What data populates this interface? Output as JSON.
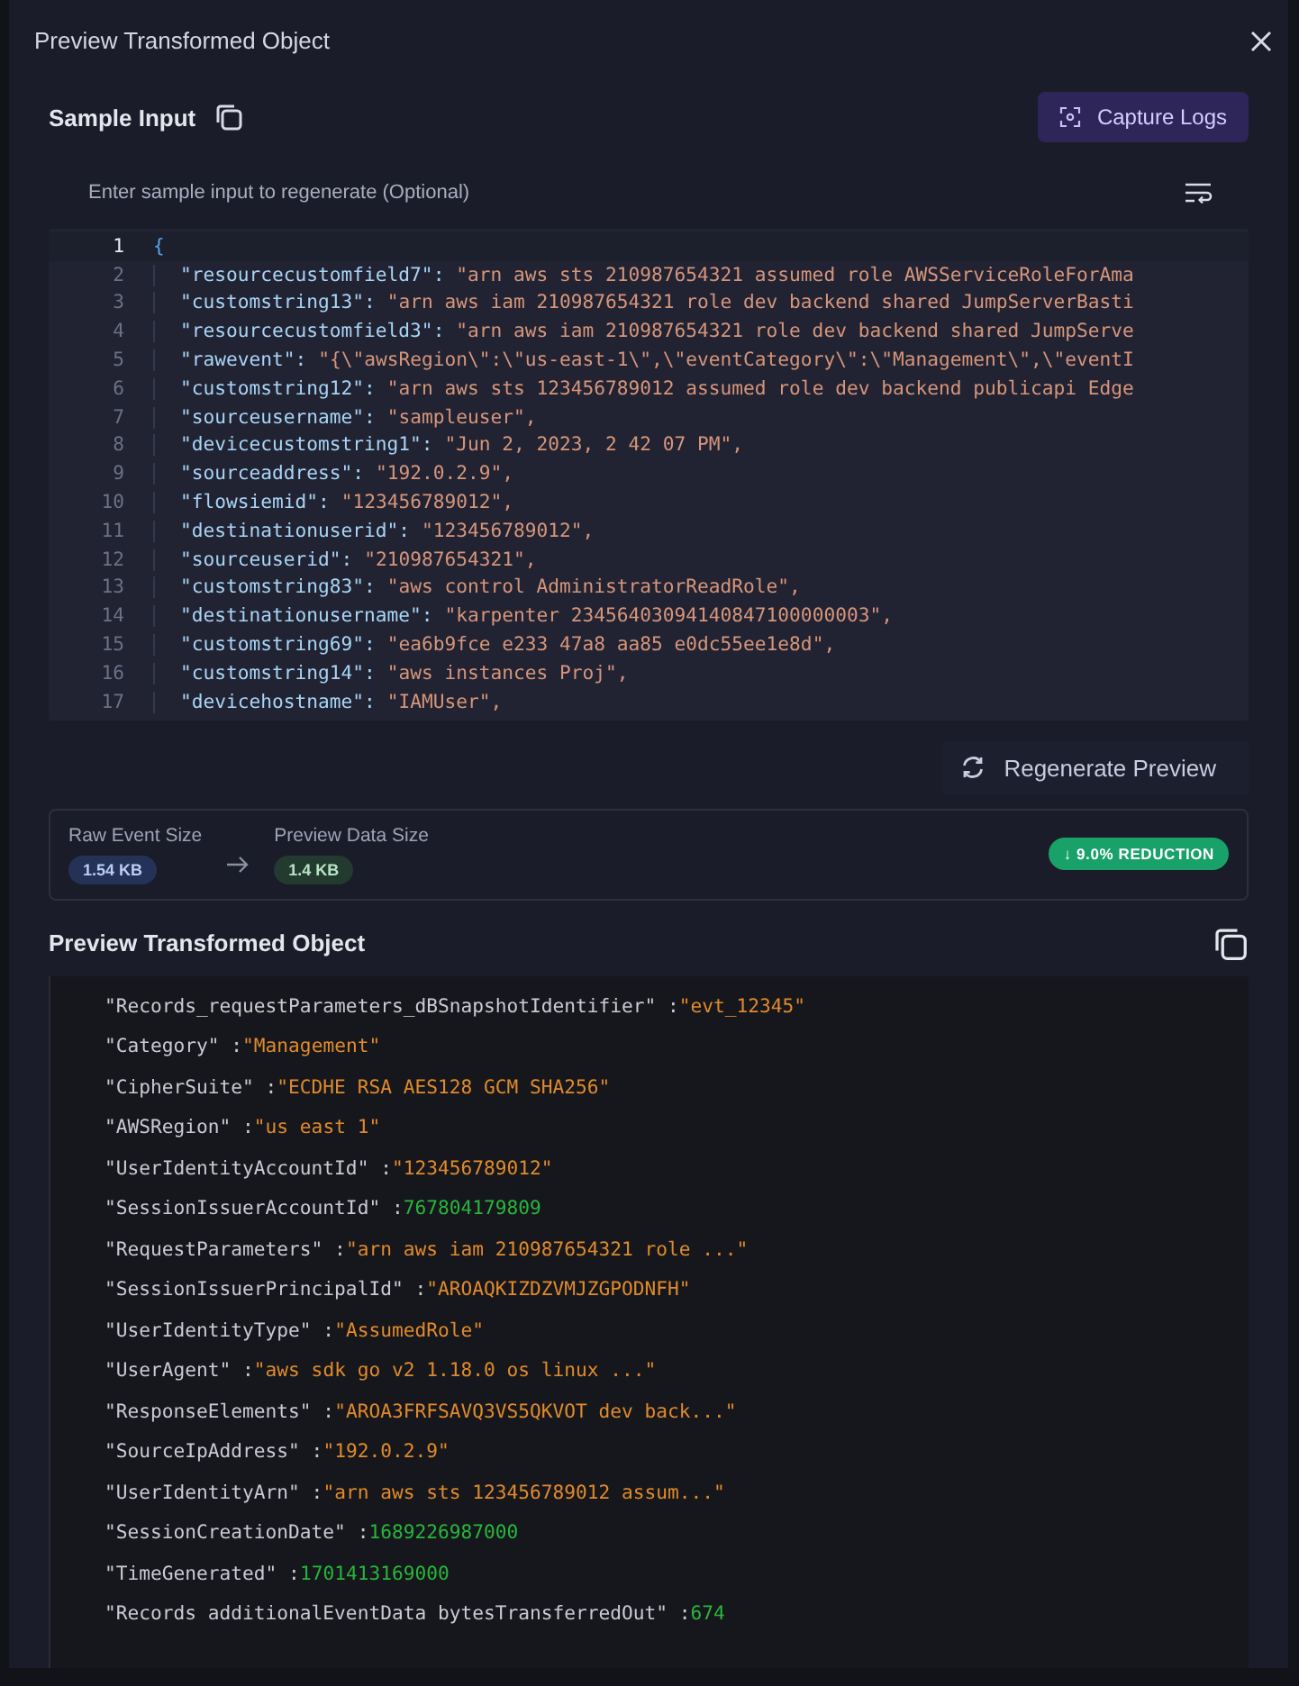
{
  "dialog": {
    "title": "Preview Transformed Object"
  },
  "sample_input": {
    "heading": "Sample Input",
    "capture_button": "Capture Logs",
    "hint": "Enter sample input to regenerate (Optional)",
    "editor_lines": [
      {
        "number": "1",
        "kind": "brace",
        "text": "{",
        "selected": true
      },
      {
        "number": "2",
        "kind": "pair",
        "key": "\"resourcecustomfield7\":",
        "value": "\"arn aws sts 210987654321 assumed role AWSServiceRoleForAma",
        "selected": false
      },
      {
        "number": "3",
        "kind": "pair",
        "key": "\"customstring13\":",
        "value": "\"arn aws iam 210987654321 role dev backend shared JumpServerBasti",
        "selected": false
      },
      {
        "number": "4",
        "kind": "pair",
        "key": "\"resourcecustomfield3\":",
        "value": "\"arn aws iam 210987654321 role dev backend shared JumpServe",
        "selected": false
      },
      {
        "number": "5",
        "kind": "pair",
        "key": "\"rawevent\":",
        "value": "\"{\\\"awsRegion\\\":\\\"us-east-1\\\",\\\"eventCategory\\\":\\\"Management\\\",\\\"eventI",
        "selected": false
      },
      {
        "number": "6",
        "kind": "pair",
        "key": "\"customstring12\":",
        "value": "\"arn aws sts 123456789012 assumed role dev backend publicapi Edge",
        "selected": false
      },
      {
        "number": "7",
        "kind": "pair",
        "key": "\"sourceusername\":",
        "value": "\"sampleuser\",",
        "selected": false
      },
      {
        "number": "8",
        "kind": "pair",
        "key": "\"devicecustomstring1\":",
        "value": "\"Jun 2, 2023, 2 42 07 PM\",",
        "selected": false
      },
      {
        "number": "9",
        "kind": "pair",
        "key": "\"sourceaddress\":",
        "value": "\"192.0.2.9\",",
        "selected": false
      },
      {
        "number": "10",
        "kind": "pair",
        "key": "\"flowsiemid\":",
        "value": "\"123456789012\",",
        "selected": false
      },
      {
        "number": "11",
        "kind": "pair",
        "key": "\"destinationuserid\":",
        "value": "\"123456789012\",",
        "selected": false
      },
      {
        "number": "12",
        "kind": "pair",
        "key": "\"sourceuserid\":",
        "value": "\"210987654321\",",
        "selected": false
      },
      {
        "number": "13",
        "kind": "pair",
        "key": "\"customstring83\":",
        "value": "\"aws control AdministratorReadRole\",",
        "selected": false
      },
      {
        "number": "14",
        "kind": "pair",
        "key": "\"destinationusername\":",
        "value": "\"karpenter 23456403094140847100000003\",",
        "selected": false
      },
      {
        "number": "15",
        "kind": "pair",
        "key": "\"customstring69\":",
        "value": "\"ea6b9fce e233 47a8 aa85 e0dc55ee1e8d\",",
        "selected": false
      },
      {
        "number": "16",
        "kind": "pair",
        "key": "\"customstring14\":",
        "value": "\"aws instances Proj\",",
        "selected": false
      },
      {
        "number": "17",
        "kind": "pair",
        "key": "\"devicehostname\":",
        "value": "\"IAMUser\",",
        "selected": false
      }
    ]
  },
  "regenerate_button": "Regenerate Preview",
  "sizes": {
    "raw_label": "Raw Event Size",
    "raw_value": "1.54 KB",
    "preview_label": "Preview Data Size",
    "preview_value": "1.4 KB",
    "reduction": "↓ 9.0% REDUCTION"
  },
  "preview": {
    "heading": "Preview Transformed Object",
    "fields": [
      {
        "key": "\"Records_requestParameters_dBSnapshotIdentifier\" :",
        "value": "\"evt_12345\"",
        "kind": "string"
      },
      {
        "key": "\"Category\" :",
        "value": "\"Management\"",
        "kind": "string"
      },
      {
        "key": "\"CipherSuite\" :",
        "value": "\"ECDHE RSA AES128 GCM SHA256\"",
        "kind": "string"
      },
      {
        "key": "\"AWSRegion\" :",
        "value": "\"us east 1\"",
        "kind": "string"
      },
      {
        "key": "\"UserIdentityAccountId\" :",
        "value": "\"123456789012\"",
        "kind": "string"
      },
      {
        "key": "\"SessionIssuerAccountId\" :",
        "value": "767804179809",
        "kind": "number"
      },
      {
        "key": "\"RequestParameters\" :",
        "value": "\"arn aws iam 210987654321 role ...\"",
        "kind": "string"
      },
      {
        "key": "\"SessionIssuerPrincipalId\" :",
        "value": "\"AROAQKIZDZVMJZGPODNFH\"",
        "kind": "string"
      },
      {
        "key": "\"UserIdentityType\" :",
        "value": "\"AssumedRole\"",
        "kind": "string"
      },
      {
        "key": "\"UserAgent\" :",
        "value": "\"aws sdk go v2 1.18.0 os linux ...\"",
        "kind": "string"
      },
      {
        "key": "\"ResponseElements\" :",
        "value": "\"AROA3FRFSAVQ3VS5QKVOT dev back...\"",
        "kind": "string"
      },
      {
        "key": "\"SourceIpAddress\" :",
        "value": "\"192.0.2.9\"",
        "kind": "string"
      },
      {
        "key": "\"UserIdentityArn\" :",
        "value": "\"arn aws sts 123456789012 assum...\"",
        "kind": "string"
      },
      {
        "key": "\"SessionCreationDate\" :",
        "value": "1689226987000",
        "kind": "number"
      },
      {
        "key": "\"TimeGenerated\" :",
        "value": "1701413169000",
        "kind": "number"
      },
      {
        "key": "\"Records additionalEventData bytesTransferredOut\" :",
        "value": "674",
        "kind": "number"
      }
    ]
  }
}
